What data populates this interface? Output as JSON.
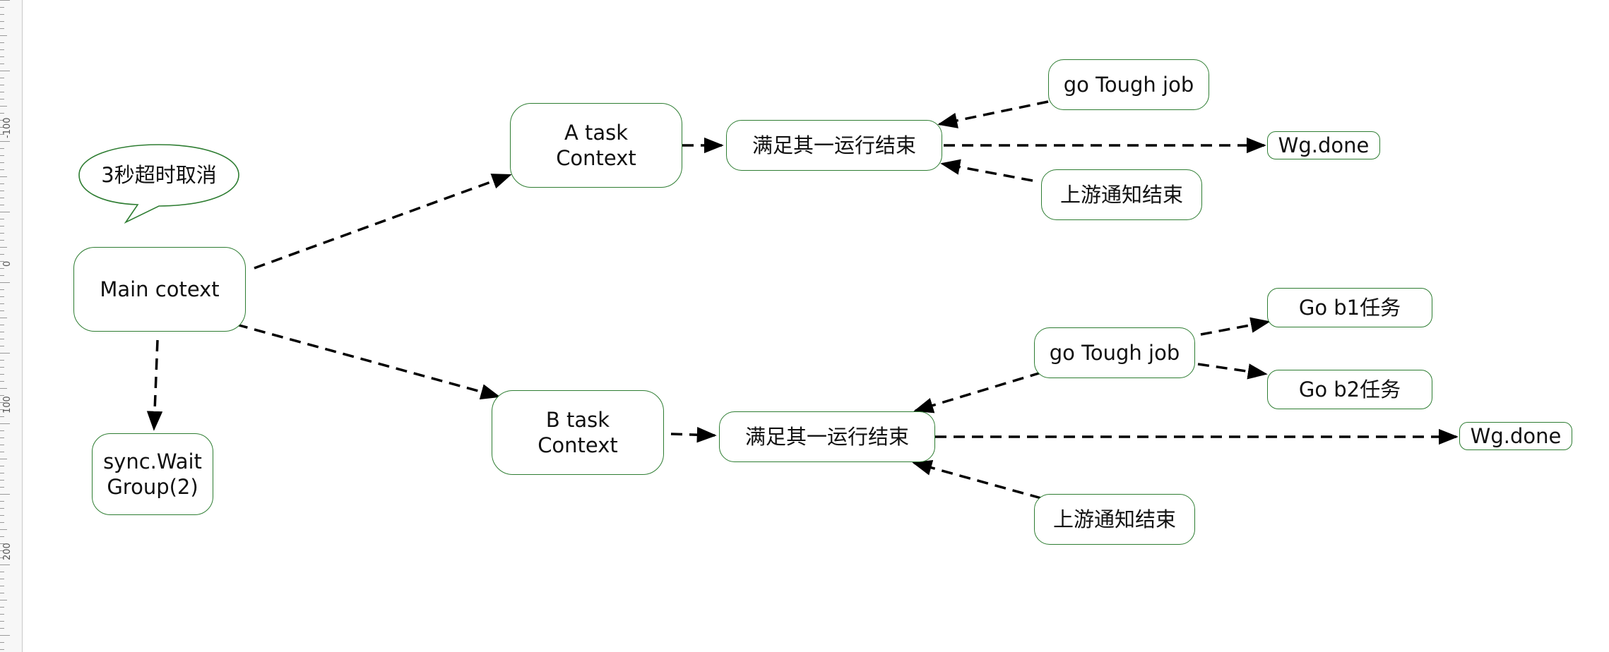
{
  "ruler": {
    "labels": [
      "-100",
      "0",
      "100",
      "200"
    ]
  },
  "callout": {
    "text": "3秒超时取消"
  },
  "nodes": {
    "main": "Main cotext",
    "waitgroup": "sync.Wait\nGroup(2)",
    "a_task": "A task\nContext",
    "b_task": "B task\nContext",
    "a_satisfy": "满足其一运行结束",
    "b_satisfy": "满足其一运行结束",
    "a_tough": "go Tough job",
    "b_tough": "go Tough job",
    "a_upstream": "上游通知结束",
    "b_upstream": "上游通知结束",
    "a_wgdone": "Wg.done",
    "b_wgdone": "Wg.done",
    "b1": "Go b1任务",
    "b2": "Go b2任务"
  },
  "colors": {
    "border": "#2e7d32",
    "arrow": "#000000"
  }
}
